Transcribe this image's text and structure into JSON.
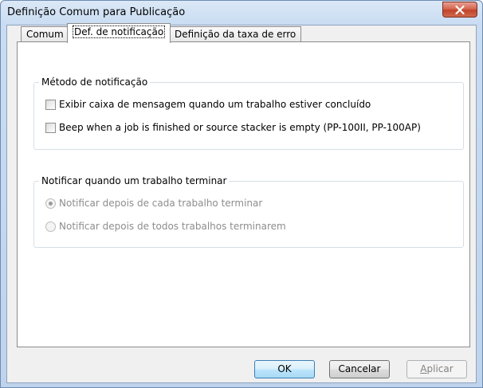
{
  "window": {
    "title": "Definição Comum para Publicação"
  },
  "tabs": [
    {
      "label": "Comum",
      "active": false
    },
    {
      "label": "Def. de notificação",
      "active": true
    },
    {
      "label": "Definição da taxa de erro",
      "active": false
    }
  ],
  "notification_method": {
    "legend": "Método de notificação",
    "options": [
      {
        "label": "Exibir caixa de mensagem quando um trabalho estiver concluído",
        "checked": false
      },
      {
        "label": "Beep when a job is finished or source stacker is empty (PP-100II, PP-100AP)",
        "checked": false
      }
    ]
  },
  "notify_when": {
    "legend": "Notificar quando um trabalho terminar",
    "enabled": false,
    "options": [
      {
        "label": "Notificar depois de cada trabalho terminar",
        "selected": true
      },
      {
        "label": "Notificar depois de todos trabalhos terminarem",
        "selected": false
      }
    ]
  },
  "buttons": {
    "ok": "OK",
    "cancel": "Cancelar",
    "apply_first": "A",
    "apply_rest": "plicar"
  },
  "icons": {
    "close": "close-icon"
  },
  "colors": {
    "titlebar": "#c9dcf2",
    "close_button": "#c0442a",
    "default_button_border": "#3c7fb1"
  }
}
